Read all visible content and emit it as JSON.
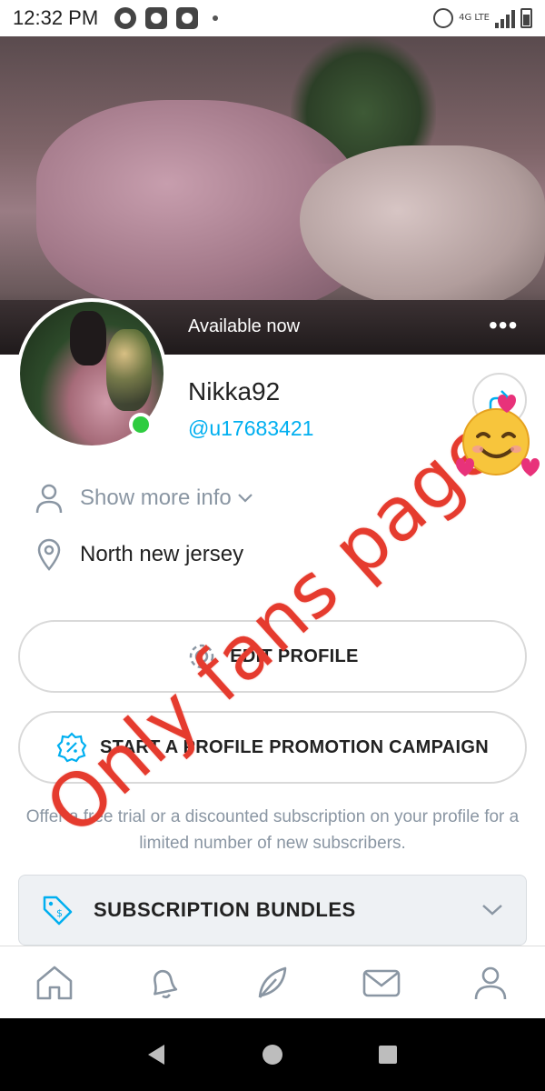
{
  "status_bar": {
    "time": "12:32 PM",
    "network": "4G LTE"
  },
  "banner": {
    "status_text": "Available now",
    "more_icon": "•••"
  },
  "profile": {
    "name": "Nikka92",
    "handle": "@u17683421"
  },
  "info": {
    "show_more": "Show more info",
    "location": "North new jersey"
  },
  "buttons": {
    "edit_profile": "EDIT PROFILE",
    "promo_campaign": "START A PROFILE PROMOTION CAMPAIGN"
  },
  "promo_description": "Offer a free trial or a discounted subscription on your profile for a limited number of new subscribers.",
  "bundles": {
    "label": "SUBSCRIPTION BUNDLES"
  },
  "annotation": {
    "text": "Only fans page"
  },
  "colors": {
    "accent": "#00aff0",
    "online": "#2ecc40",
    "annotation": "#e53b2e",
    "muted": "#8a96a3"
  },
  "icons": {
    "nav": [
      "home-icon",
      "bell-icon",
      "feather-icon",
      "mail-icon",
      "user-icon"
    ],
    "android": [
      "back-icon",
      "home-icon",
      "recents-icon"
    ]
  }
}
